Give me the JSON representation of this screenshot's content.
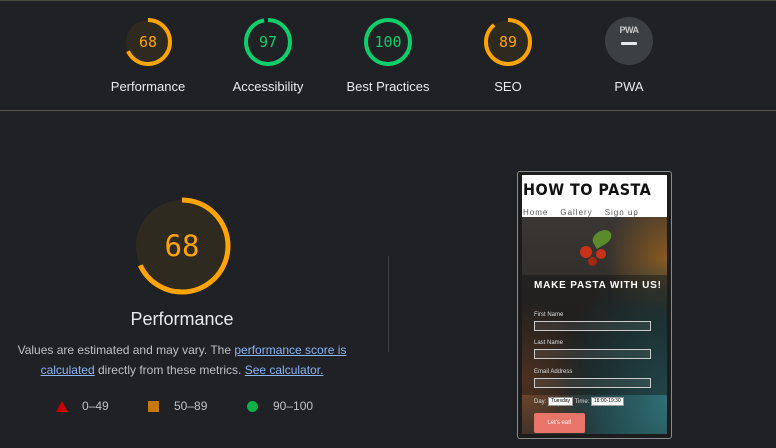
{
  "summary": {
    "gauges": [
      {
        "name": "performance",
        "score": "68",
        "label": "Performance",
        "color": "#ffa400",
        "fraction": 0.68
      },
      {
        "name": "accessibility",
        "score": "97",
        "label": "Accessibility",
        "color": "#0cce6b",
        "fraction": 0.97
      },
      {
        "name": "best-practices",
        "score": "100",
        "label": "Best Practices",
        "color": "#0cce6b",
        "fraction": 1.0
      },
      {
        "name": "seo",
        "score": "89",
        "label": "SEO",
        "color": "#ffa400",
        "fraction": 0.89
      }
    ],
    "pwa": {
      "badge_text": "PWA",
      "label": "PWA"
    }
  },
  "main": {
    "gauge": {
      "score": "68",
      "color": "#ffa400",
      "fraction": 0.68
    },
    "title": "Performance",
    "description": {
      "prefix": "Values are estimated and may vary. The ",
      "link1": "performance score is calculated",
      "middle": " directly from these metrics. ",
      "link2": "See calculator."
    },
    "legend": [
      {
        "shape": "triangle",
        "range": "0–49",
        "color": "#cc0000"
      },
      {
        "shape": "square",
        "range": "50–89",
        "color": "#c7780a"
      },
      {
        "shape": "circle",
        "range": "90–100",
        "color": "#0cb04a"
      }
    ]
  },
  "screenshot": {
    "site_title": "HOW TO PASTA",
    "nav": [
      "Home",
      "Gallery",
      "Sign up"
    ],
    "form_title": "MAKE PASTA WITH US!",
    "fields": [
      "First Name",
      "Last Name",
      "Email Address"
    ],
    "day_label": "Day:",
    "day_value": "Tuesday",
    "time_label": "Time:",
    "time_value": "18:00-19:30",
    "submit": "Let's eat!"
  }
}
